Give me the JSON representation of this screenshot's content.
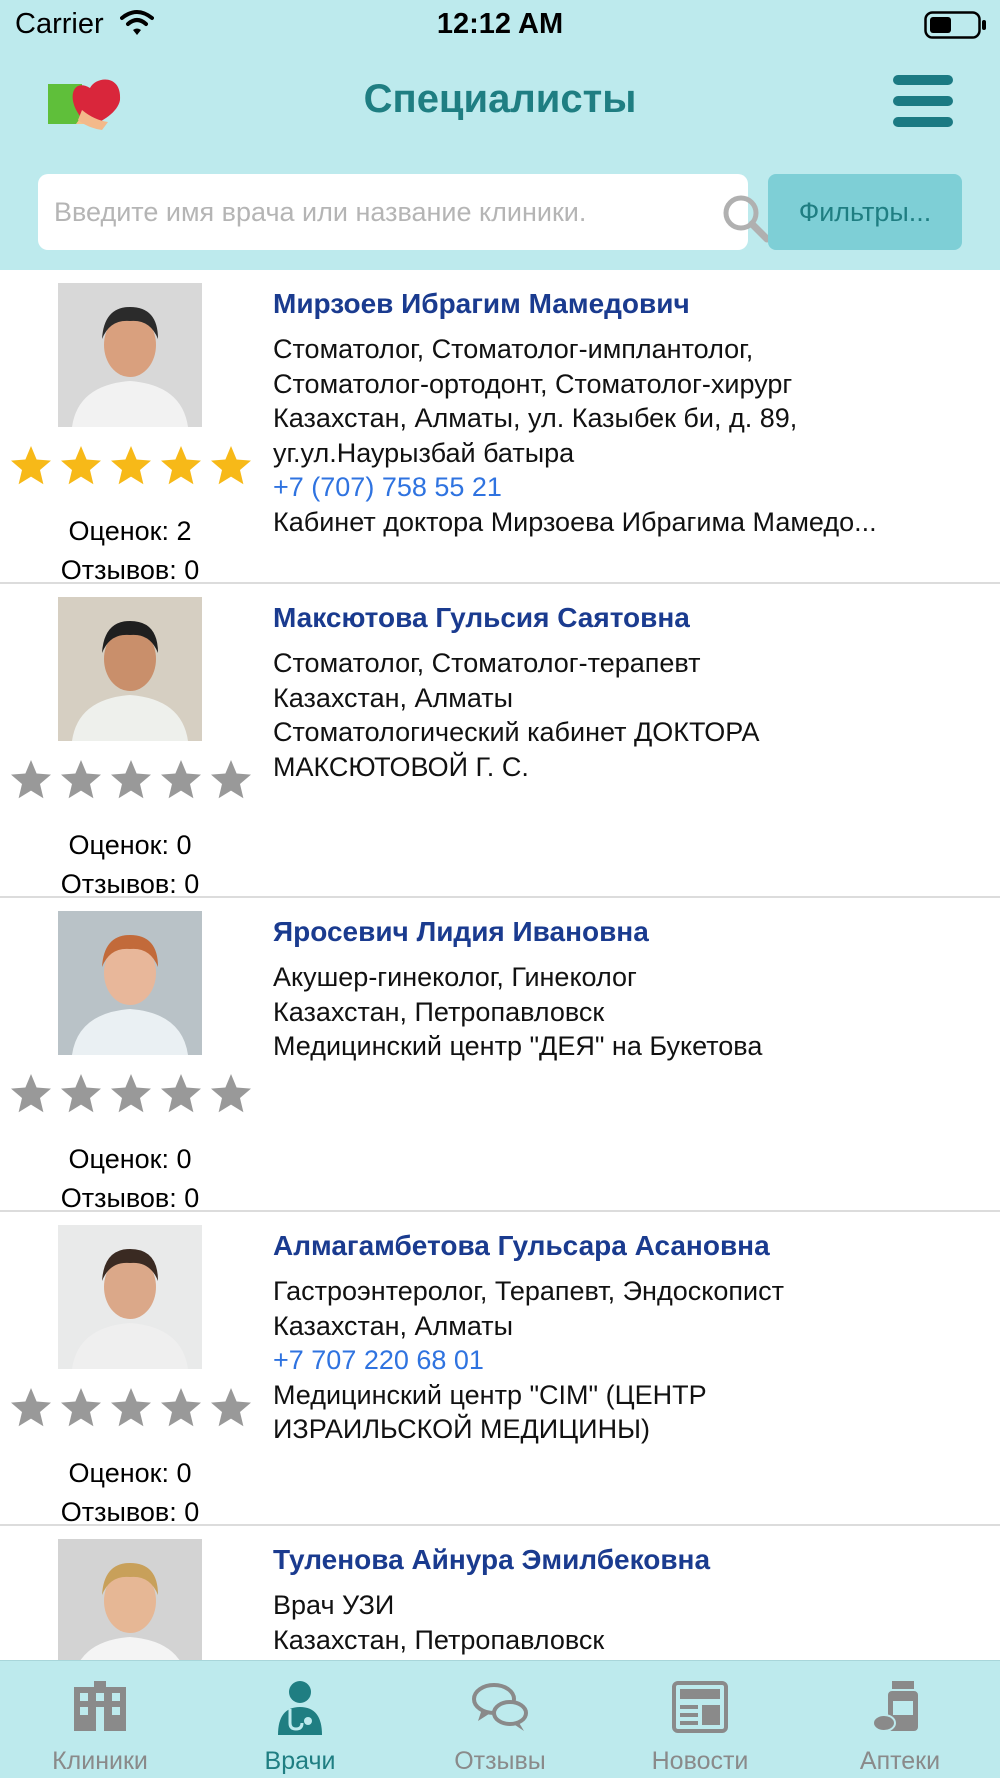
{
  "status": {
    "carrier": "Carrier",
    "time": "12:12 AM"
  },
  "header": {
    "title": "Специалисты",
    "logo_icon": "heart-book-logo",
    "menu_icon": "hamburger-icon"
  },
  "search": {
    "placeholder": "Введите имя врача или название клиники.",
    "value": "",
    "filter_label": "Фильтры..."
  },
  "colors": {
    "header_bg": "#bdeaed",
    "title": "#1f7e82",
    "name": "#1a3b8f",
    "phone": "#2f73e0",
    "star_gold": "#f7b918",
    "star_gray": "#999999"
  },
  "doctors": [
    {
      "name": "Мирзоев Ибрагим Мамедович",
      "lines": [
        "Стоматолог, Стоматолог-имплантолог,",
        "Стоматолог-ортодонт, Стоматолог-хирург",
        "Казахстан, Алматы, ул. Казыбек би, д. 89,",
        "уг.ул.Наурызбай батыра",
        "+7 (707) 758 55 21",
        "Кабинет доктора Мирзоева Ибрагима Мамедо..."
      ],
      "phone_index": 4,
      "stars": 5,
      "ratings_label": "Оценок: 2",
      "reviews_label": "Отзывов: 0"
    },
    {
      "name": "Максютова Гульсия Саятовна",
      "lines": [
        "Стоматолог, Стоматолог-терапевт",
        "Казахстан, Алматы",
        "Стоматологический кабинет ДОКТОРА",
        "МАКСЮТОВОЙ Г. С."
      ],
      "phone_index": -1,
      "stars": 0,
      "ratings_label": "Оценок: 0",
      "reviews_label": "Отзывов: 0"
    },
    {
      "name": "Яросевич Лидия Ивановна",
      "lines": [
        "Акушер-гинеколог, Гинеколог",
        "Казахстан, Петропавловск",
        "Медицинский центр \"ДЕЯ\" на Букетова"
      ],
      "phone_index": -1,
      "stars": 0,
      "ratings_label": "Оценок: 0",
      "reviews_label": "Отзывов: 0"
    },
    {
      "name": "Алмагамбетова Гульсара Асановна",
      "lines": [
        "Гастроэнтеролог, Терапевт, Эндоскопист",
        "Казахстан, Алматы",
        "+7 707 220 68 01",
        "Медицинский центр \"CIM\" (ЦЕНТР",
        "ИЗРАИЛЬСКОЙ МЕДИЦИНЫ)"
      ],
      "phone_index": 2,
      "stars": 0,
      "ratings_label": "Оценок: 0",
      "reviews_label": "Отзывов: 0"
    },
    {
      "name": "Туленова Айнура Эмилбековна",
      "lines": [
        "Врач УЗИ",
        "Казахстан, Петропавловск"
      ],
      "phone_index": -1,
      "stars": 0,
      "ratings_label": "",
      "reviews_label": ""
    }
  ],
  "tabs": [
    {
      "label": "Клиники",
      "icon": "clinic-building-icon",
      "active": false
    },
    {
      "label": "Врачи",
      "icon": "doctor-icon",
      "active": true
    },
    {
      "label": "Отзывы",
      "icon": "chat-bubbles-icon",
      "active": false
    },
    {
      "label": "Новости",
      "icon": "newspaper-icon",
      "active": false
    },
    {
      "label": "Аптеки",
      "icon": "pills-icon",
      "active": false
    }
  ]
}
